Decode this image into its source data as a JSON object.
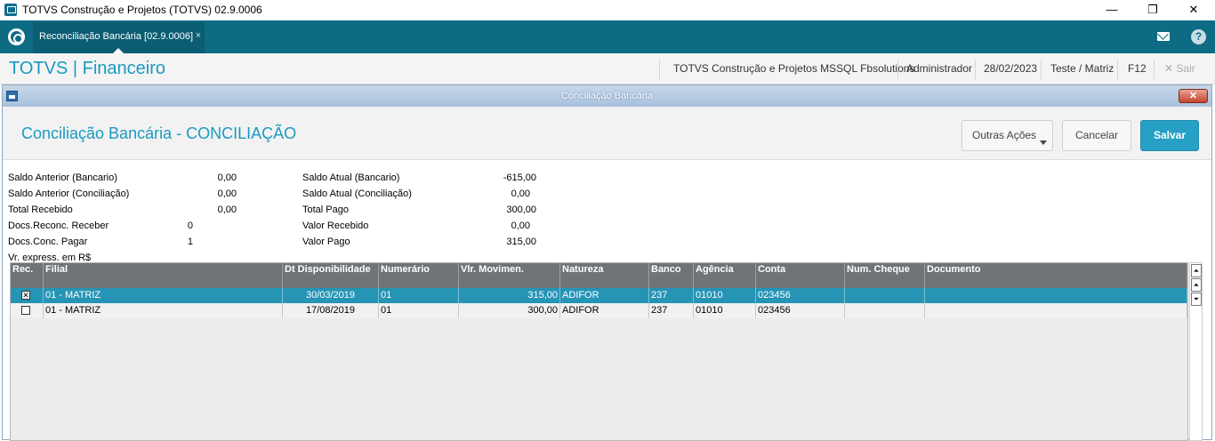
{
  "window": {
    "title": "TOTVS Construção e Projetos (TOTVS) 02.9.0006",
    "min_glyph": "—",
    "max_glyph": "❐",
    "close_glyph": "✕"
  },
  "appbar": {
    "tab_label": "Reconciliação Bancária [02.9.0006]",
    "tab_close": "×",
    "help_glyph": "?"
  },
  "prodbar": {
    "brand": "TOTVS | Financeiro",
    "company": "TOTVS Construção e Projetos MSSQL Fbsolutions",
    "user": "Administrador",
    "date": "28/02/2023",
    "environment": "Teste / Matriz",
    "shortcut": "F12",
    "exit_icon": "✕",
    "exit_label": "Sair"
  },
  "dialog": {
    "title": "Conciliação Bancária",
    "close_glyph": "✕",
    "page_title": "Conciliação Bancária - CONCILIAÇÃO",
    "buttons": {
      "more_actions": "Outras Ações",
      "cancel": "Cancelar",
      "save": "Salvar"
    }
  },
  "summary": {
    "left": [
      {
        "label": "Saldo Anterior (Bancario)",
        "value": "0,00"
      },
      {
        "label": "Saldo Anterior (Conciliação)",
        "value": "0,00"
      },
      {
        "label": "Total Recebido",
        "value": "0,00"
      },
      {
        "label": "Docs.Reconc. Receber",
        "value": "0"
      },
      {
        "label": "Docs.Conc. Pagar",
        "value": "1"
      }
    ],
    "right": [
      {
        "label": "Saldo Atual (Bancario)",
        "value": "-615,00"
      },
      {
        "label": "Saldo Atual (Conciliação)",
        "value": "0,00"
      },
      {
        "label": "Total Pago",
        "value": "300,00"
      },
      {
        "label": "Valor Recebido",
        "value": "0,00"
      },
      {
        "label": "Valor Pago",
        "value": "315,00"
      }
    ],
    "currency_note": "Vr. express. em R$"
  },
  "grid": {
    "columns": [
      "Rec.",
      "Filial",
      "Dt Disponibilidade",
      "Numerário",
      "Vlr. Movimen.",
      "Natureza",
      "Banco",
      "Agência",
      "Conta",
      "Num. Cheque",
      "Documento"
    ],
    "rows": [
      {
        "checked": true,
        "check_glyph": "✕",
        "filial": "01 - MATRIZ",
        "data": "30/03/2019",
        "numerario": "01",
        "valor": "315,00",
        "natureza": "ADIFOR",
        "banco": "237",
        "agencia": "01010",
        "conta": "023456",
        "cheque": "",
        "documento": ""
      },
      {
        "checked": false,
        "check_glyph": "",
        "filial": "01 - MATRIZ",
        "data": "17/08/2019",
        "numerario": "01",
        "valor": "300,00",
        "natureza": "ADIFOR",
        "banco": "237",
        "agencia": "01010",
        "conta": "023456",
        "cheque": "",
        "documento": ""
      }
    ]
  },
  "scrollbar": {
    "top_glyph": "⏶",
    "pageup_glyph": "⏶",
    "down_glyph": "⏷"
  }
}
